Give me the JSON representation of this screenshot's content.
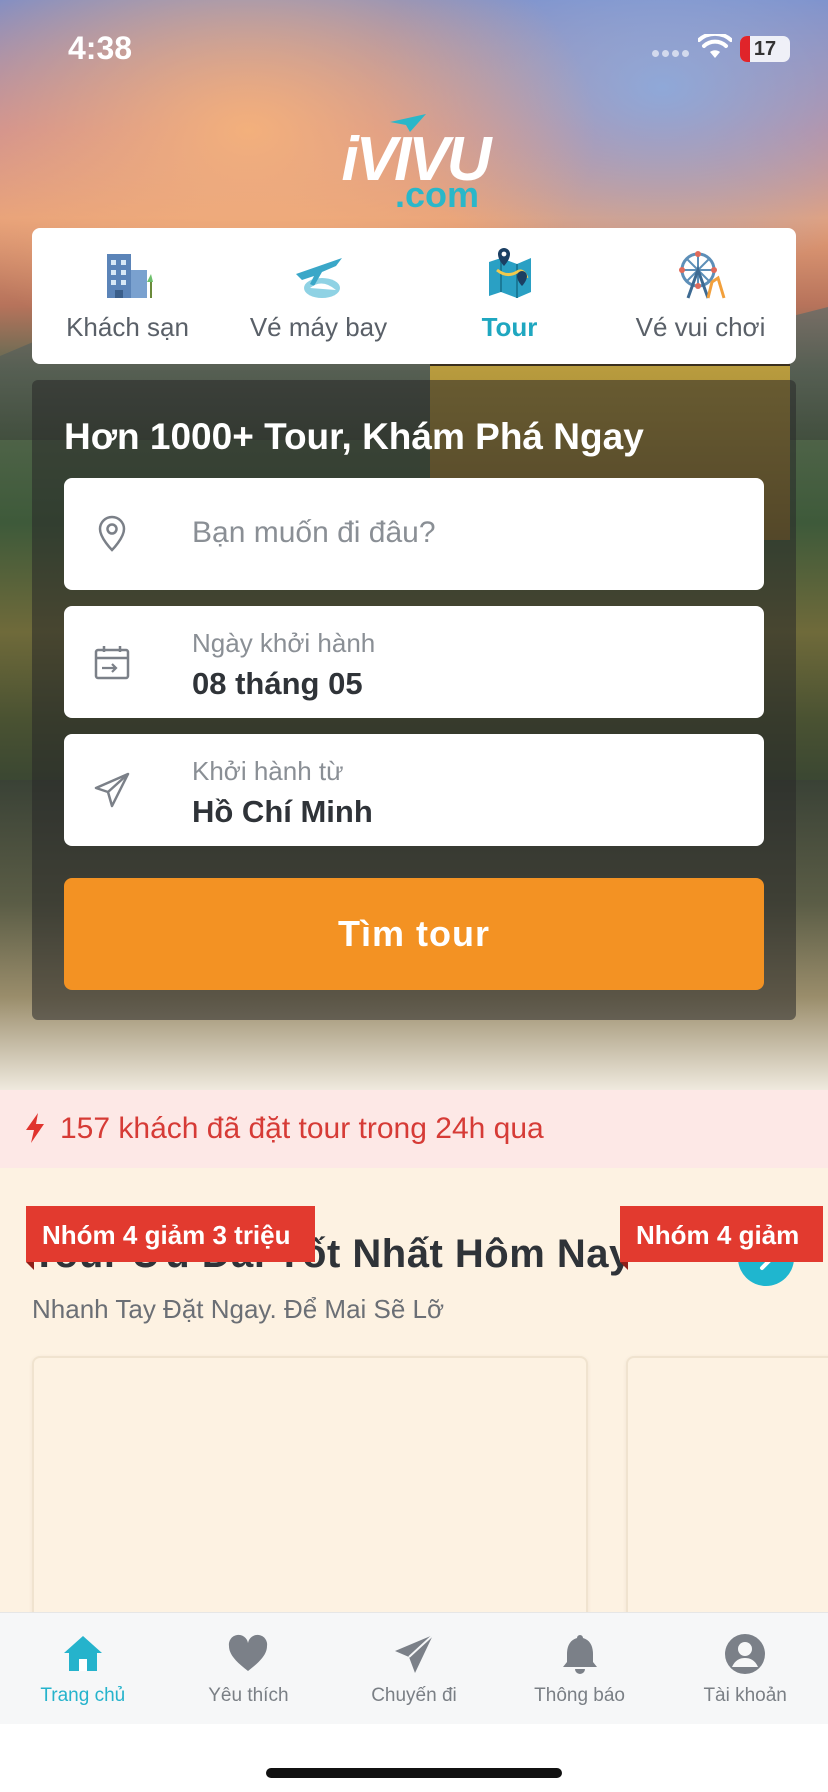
{
  "status_bar": {
    "time": "4:38",
    "battery": "17"
  },
  "brand": {
    "name": "iVIVU",
    "domain": ".com"
  },
  "categories": [
    {
      "label": "Khách sạn",
      "icon": "hotel-icon",
      "active": false
    },
    {
      "label": "Vé máy bay",
      "icon": "airplane-icon",
      "active": false
    },
    {
      "label": "Tour",
      "icon": "map-icon",
      "active": true
    },
    {
      "label": "Vé vui chơi",
      "icon": "ferris-wheel-icon",
      "active": false
    }
  ],
  "search": {
    "title": "Hơn 1000+ Tour, Khám Phá Ngay",
    "destination_placeholder": "Bạn muốn đi đâu?",
    "date_label": "Ngày khởi hành",
    "date_value": "08 tháng 05",
    "from_label": "Khởi hành từ",
    "from_value": "Hồ Chí Minh",
    "button": "Tìm tour"
  },
  "notice": {
    "text": "157 khách đã đặt tour trong 24h qua",
    "icon": "lightning-icon"
  },
  "deals": {
    "title": "Tour Ưu Đãi Tốt Nhất Hôm Nay",
    "subtitle": "Nhanh Tay Đặt Ngay. Để Mai Sẽ Lỡ",
    "cards": [
      {
        "ribbon": "Nhóm 4 giảm 3 triệu"
      },
      {
        "ribbon": "Nhóm 4 giảm"
      }
    ]
  },
  "tabbar": [
    {
      "label": "Trang chủ",
      "icon": "home-icon",
      "active": true
    },
    {
      "label": "Yêu thích",
      "icon": "heart-icon",
      "active": false
    },
    {
      "label": "Chuyến đi",
      "icon": "paper-plane-icon",
      "active": false
    },
    {
      "label": "Thông báo",
      "icon": "bell-icon",
      "active": false
    },
    {
      "label": "Tài khoản",
      "icon": "account-icon",
      "active": false
    }
  ],
  "colors": {
    "accent": "#1fa7c0",
    "cta": "#f39223",
    "alert": "#d63b36",
    "ribbon": "#e23a2f"
  }
}
